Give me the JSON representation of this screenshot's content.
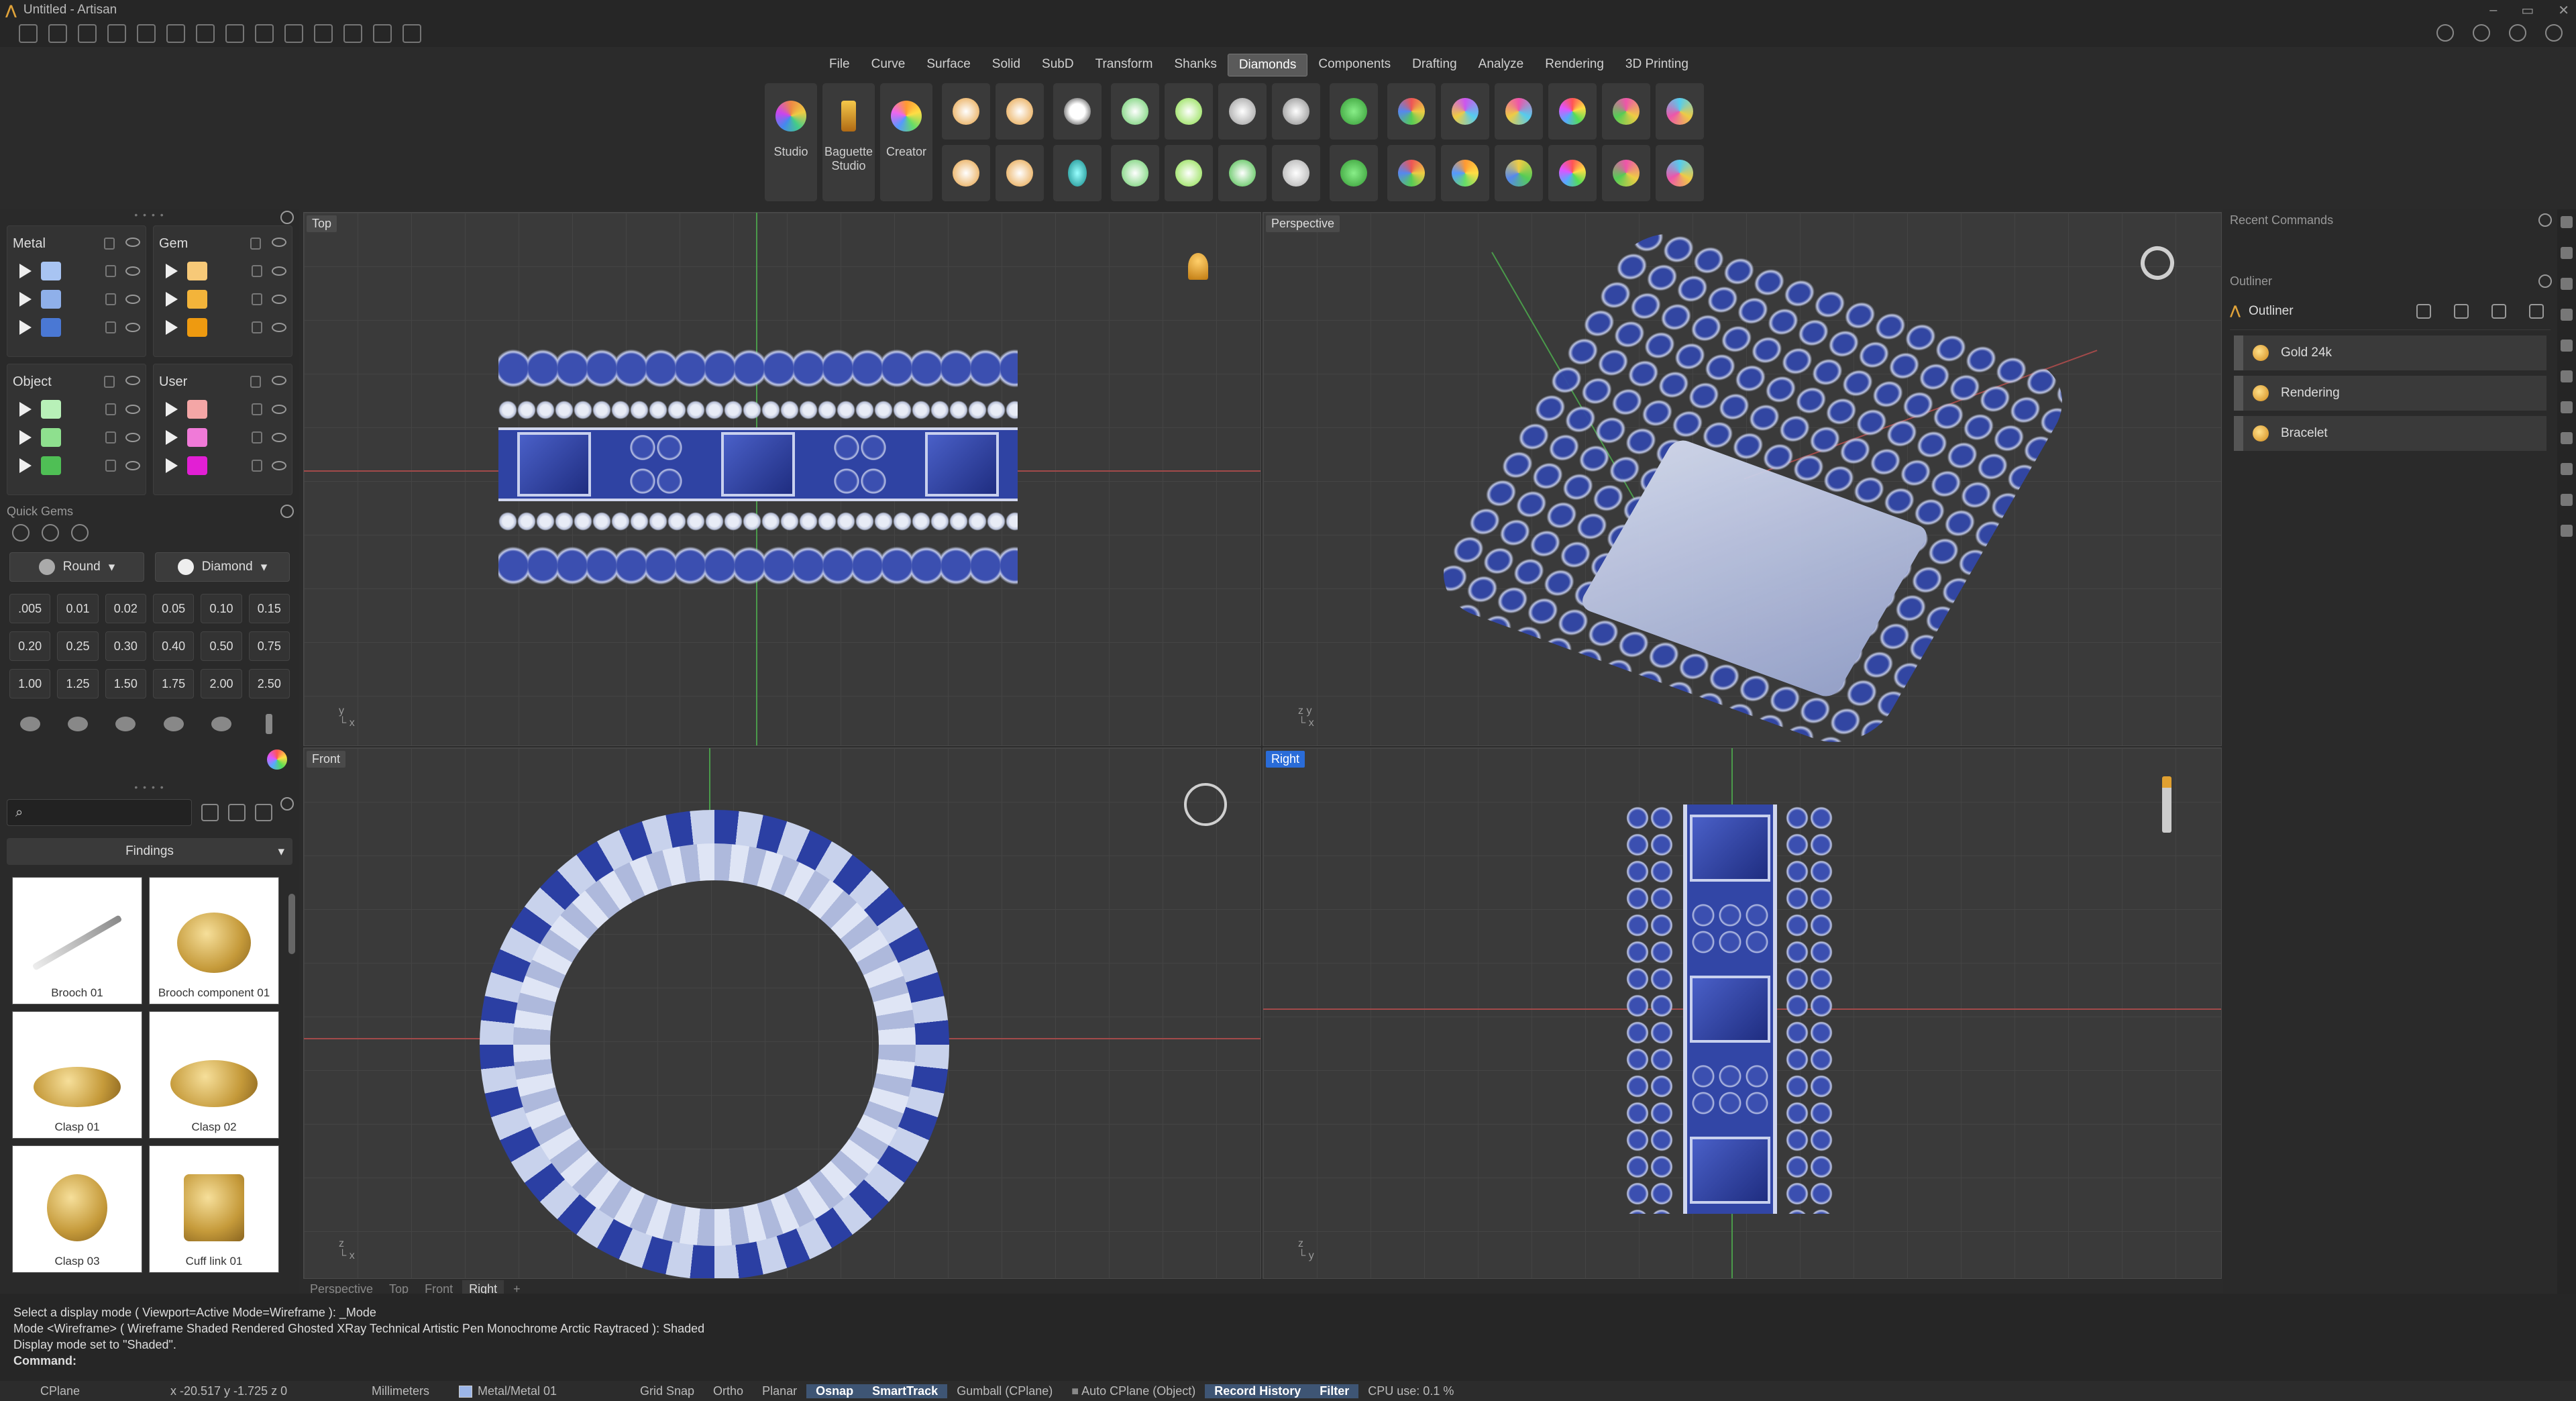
{
  "window": {
    "title": "Untitled - Artisan",
    "controls": [
      "–",
      "▭",
      "✕"
    ]
  },
  "menu_tabs": [
    {
      "label": "File",
      "active": false
    },
    {
      "label": "Curve",
      "active": false
    },
    {
      "label": "Surface",
      "active": false
    },
    {
      "label": "Solid",
      "active": false
    },
    {
      "label": "SubD",
      "active": false
    },
    {
      "label": "Transform",
      "active": false
    },
    {
      "label": "Shanks",
      "active": false
    },
    {
      "label": "Diamonds",
      "active": true
    },
    {
      "label": "Components",
      "active": false
    },
    {
      "label": "Drafting",
      "active": false
    },
    {
      "label": "Analyze",
      "active": false
    },
    {
      "label": "Rendering",
      "active": false
    },
    {
      "label": "3D Printing",
      "active": false
    }
  ],
  "ribbon": {
    "studio": "Studio",
    "baguette_studio_line1": "Baguette",
    "baguette_studio_line2": "Studio",
    "creator": "Creator"
  },
  "layers": {
    "metal": {
      "title": "Metal",
      "colors": [
        "#a8c4f2",
        "#8fb0ea",
        "#4a78d4"
      ]
    },
    "gem": {
      "title": "Gem",
      "colors": [
        "#f7c978",
        "#f3b43a",
        "#ee9a10"
      ]
    },
    "object": {
      "title": "Object",
      "colors": [
        "#b8f0b8",
        "#8ee08e",
        "#4fbf55"
      ]
    },
    "user": {
      "title": "User",
      "colors": [
        "#f4a6a6",
        "#f07ad8",
        "#e21fd4"
      ]
    }
  },
  "quick_gems": {
    "title": "Quick Gems",
    "shape": "Round",
    "material": "Diamond",
    "sizes": [
      ".005",
      "0.01",
      "0.02",
      "0.05",
      "0.10",
      "0.15",
      "0.20",
      "0.25",
      "0.30",
      "0.40",
      "0.50",
      "0.75",
      "1.00",
      "1.25",
      "1.50",
      "1.75",
      "2.00",
      "2.50"
    ]
  },
  "library": {
    "search_placeholder": "",
    "category": "Findings",
    "items": [
      "Brooch 01",
      "Brooch component 01",
      "Clasp 01",
      "Clasp 02",
      "Clasp 03",
      "Cuff link 01"
    ]
  },
  "viewports": {
    "top": "Top",
    "perspective": "Perspective",
    "front": "Front",
    "right": "Right"
  },
  "viewport_tabs": [
    "Perspective",
    "Top",
    "Front",
    "Right",
    "+"
  ],
  "right_panel": {
    "recent_commands_title": "Recent Commands",
    "outliner_title": "Outliner",
    "outliner_header": "Outliner",
    "items": [
      "Gold 24k",
      "Rendering",
      "Bracelet"
    ]
  },
  "command_area": {
    "history_line1": "Select a display mode ( Viewport=Active  Mode=Wireframe ): _Mode",
    "history_line2": "Mode <Wireframe> ( Wireframe  Shaded  Rendered  Ghosted  XRay  Technical  Artistic  Pen  Monochrome  Arctic  Raytraced ): Shaded",
    "history_line3": "Display mode set to \"Shaded\".",
    "prompt": "Command:"
  },
  "status_bar": {
    "cplane": "CPlane",
    "coords": "x -20.517   y -1.725   z 0",
    "units": "Millimeters",
    "layer": "Metal/Metal 01",
    "grid_snap": "Grid Snap",
    "ortho": "Ortho",
    "planar": "Planar",
    "osnap": "Osnap",
    "smarttrack": "SmartTrack",
    "gumball": "Gumball (CPlane)",
    "auto_cplane": "Auto CPlane (Object)",
    "record_history": "Record History",
    "filter": "Filter",
    "cpu": "CPU use: 0.1 %"
  }
}
